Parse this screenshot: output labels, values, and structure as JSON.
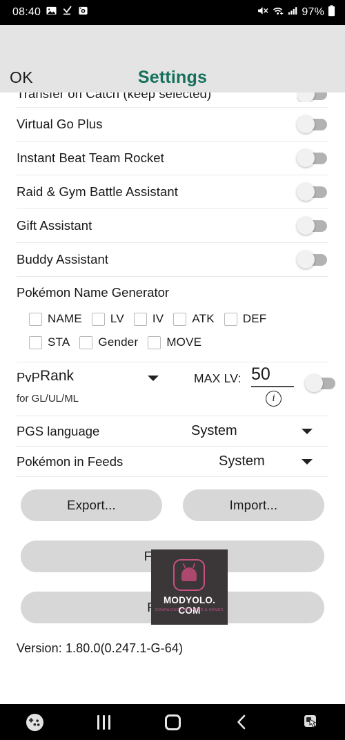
{
  "status_bar": {
    "time": "08:40",
    "battery_pct": "97%",
    "icons": [
      "photo-icon",
      "download-complete-icon",
      "camera-app-icon",
      "mute-icon",
      "wifi-icon",
      "cellular-signal-icon",
      "battery-icon"
    ]
  },
  "header": {
    "ok_label": "OK",
    "title": "Settings",
    "title_color": "#14705c",
    "bg_color": "#e4e4e4"
  },
  "settings_rows": [
    {
      "label": "Transfer on Catch (keep selected)",
      "toggle": "off",
      "clipped": true
    },
    {
      "label": "Virtual Go Plus",
      "toggle": "off",
      "clipped": false
    },
    {
      "label": "Instant Beat Team Rocket",
      "toggle": "off",
      "clipped": false
    },
    {
      "label": "Raid & Gym Battle Assistant",
      "toggle": "off",
      "clipped": false
    },
    {
      "label": "Gift Assistant",
      "toggle": "off",
      "clipped": false
    },
    {
      "label": "Buddy Assistant",
      "toggle": "off",
      "clipped": false
    }
  ],
  "name_generator": {
    "title": "Pokémon Name Generator",
    "row1": [
      {
        "label": "NAME",
        "checked": false
      },
      {
        "label": "LV",
        "checked": false
      },
      {
        "label": "IV",
        "checked": false
      },
      {
        "label": "ATK",
        "checked": false
      },
      {
        "label": "DEF",
        "checked": false
      }
    ],
    "row2": [
      {
        "label": "STA",
        "checked": false
      },
      {
        "label": "Gender",
        "checked": false
      },
      {
        "label": "MOVE",
        "checked": false
      }
    ]
  },
  "pvp": {
    "label": "PvP",
    "selected": "Rank",
    "sublabel": "for GL/UL/ML",
    "max_lv_label": "MAX LV:",
    "max_lv_value": "50",
    "info_glyph": "i",
    "toggle": "off"
  },
  "dropdowns": [
    {
      "label": "PGS language",
      "value": "System"
    },
    {
      "label": "Pokémon in Feeds",
      "value": "System"
    }
  ],
  "buttons": {
    "export": "Export...",
    "import": "Import...",
    "feedback": "Feedback",
    "reset_ui": "Reset UI"
  },
  "version": "Version: 1.80.0(0.247.1-G-64)",
  "watermark": {
    "text": "MODYOLO. COM",
    "subtext": "DOWNLOAD FREE APPS & GAMES",
    "bg_color": "#3b3638",
    "accent_color": "#e0578f"
  },
  "nav_bar": {
    "items": [
      "game-controller-icon",
      "recents-icon",
      "home-icon",
      "back-icon",
      "screen-tap-icon"
    ]
  }
}
